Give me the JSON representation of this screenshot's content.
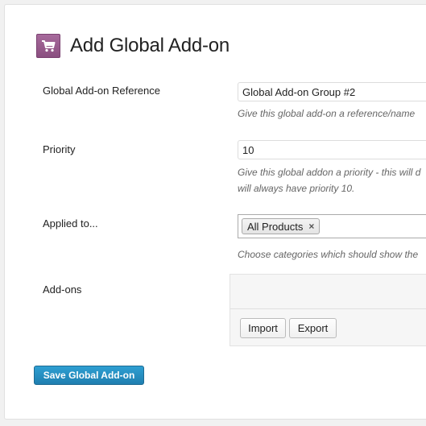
{
  "header": {
    "title": "Add Global Add-on",
    "icon": "cart-icon"
  },
  "fields": {
    "reference": {
      "label": "Global Add-on Reference",
      "value": "Global Add-on Group #2",
      "description": "Give this global add-on a reference/name"
    },
    "priority": {
      "label": "Priority",
      "value": "10",
      "description_line1": "Give this global addon a priority - this will d",
      "description_line2": "will always have priority 10."
    },
    "applied_to": {
      "label": "Applied to...",
      "tokens": [
        {
          "label": "All Products",
          "remove": "×"
        }
      ],
      "description": "Choose categories which should show the"
    },
    "addons": {
      "label": "Add-ons",
      "import_label": "Import",
      "export_label": "Export"
    }
  },
  "actions": {
    "save_label": "Save Global Add-on"
  },
  "colors": {
    "brand_purple": "#96588a",
    "primary_blue": "#2587bd"
  }
}
